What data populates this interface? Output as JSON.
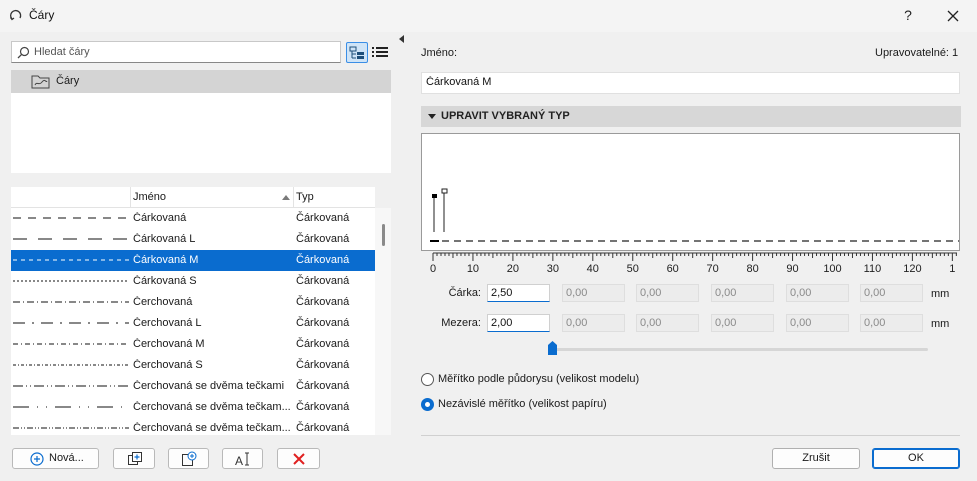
{
  "window": {
    "title": "Čáry",
    "help_label": "?"
  },
  "search": {
    "placeholder": "Hledat čáry"
  },
  "tree": {
    "root_label": "Čáry"
  },
  "list": {
    "headers": {
      "name": "Jméno",
      "type": "Typ"
    },
    "rows": [
      {
        "name": "Čárkovaná",
        "type": "Čárkovaná",
        "dash": "8,7"
      },
      {
        "name": "Čárkovaná L",
        "type": "Čárkovaná",
        "dash": "14,11"
      },
      {
        "name": "Čárkovaná M",
        "type": "Čárkovaná",
        "dash": "4,4",
        "selected": true
      },
      {
        "name": "Čárkovaná S",
        "type": "Čárkovaná",
        "dash": "2,2"
      },
      {
        "name": "Čerchovaná",
        "type": "Čárkovaná",
        "dash": "7,3,1,3"
      },
      {
        "name": "Čerchovaná L",
        "type": "Čárkovaná",
        "dash": "12,7,2,7"
      },
      {
        "name": "Čerchovaná M",
        "type": "Čárkovaná",
        "dash": "5,3,1,3"
      },
      {
        "name": "Čerchovaná S",
        "type": "Čárkovaná",
        "dash": "3,2,1,2"
      },
      {
        "name": "Čerchovaná se dvěma tečkami",
        "type": "Čárkovaná",
        "dash": "10,3,1,3,1,3"
      },
      {
        "name": "Čerchovaná se dvěma tečkam...",
        "type": "Čárkovaná",
        "dash": "16,8,1,8,1,8"
      },
      {
        "name": "Čerchovaná se dvěma tečkam...",
        "type": "Čárkovaná",
        "dash": "6,2,1,2,1,2"
      }
    ]
  },
  "bottom_buttons": {
    "new_label": "Nová..."
  },
  "editor": {
    "name_label": "Jméno:",
    "editable_label": "Upravovatelné: 1",
    "name_value": "Čárkovaná M",
    "section_title": "UPRAVIT VYBRANÝ TYP",
    "ruler_ticks": [
      "0",
      "10",
      "20",
      "30",
      "40",
      "50",
      "60",
      "70",
      "80",
      "90",
      "100",
      "110",
      "120",
      "1"
    ],
    "dash_label": "Čárka:",
    "gap_label": "Mezera:",
    "dash_values": [
      "2,50",
      "0,00",
      "0,00",
      "0,00",
      "0,00",
      "0,00"
    ],
    "gap_values": [
      "2,00",
      "0,00",
      "0,00",
      "0,00",
      "0,00",
      "0,00"
    ],
    "unit": "mm",
    "scale_options": [
      {
        "label": "Měřítko podle půdorysu (velikost modelu)",
        "checked": false
      },
      {
        "label": "Nezávislé měřítko (velikost papíru)",
        "checked": true
      }
    ]
  },
  "dialog_buttons": {
    "cancel": "Zrušit",
    "ok": "OK"
  },
  "colors": {
    "accent": "#0a6ccf",
    "section_bg": "#d7d7d7",
    "pane_bg": "#f0f0f0"
  },
  "icons": [
    "refresh-icon",
    "help-icon",
    "close-icon",
    "search-icon",
    "tree-view-icon",
    "list-view-icon",
    "folder-line-icon",
    "add-circle-icon",
    "duplicate-icon",
    "import-icon",
    "rename-icon",
    "delete-icon"
  ]
}
